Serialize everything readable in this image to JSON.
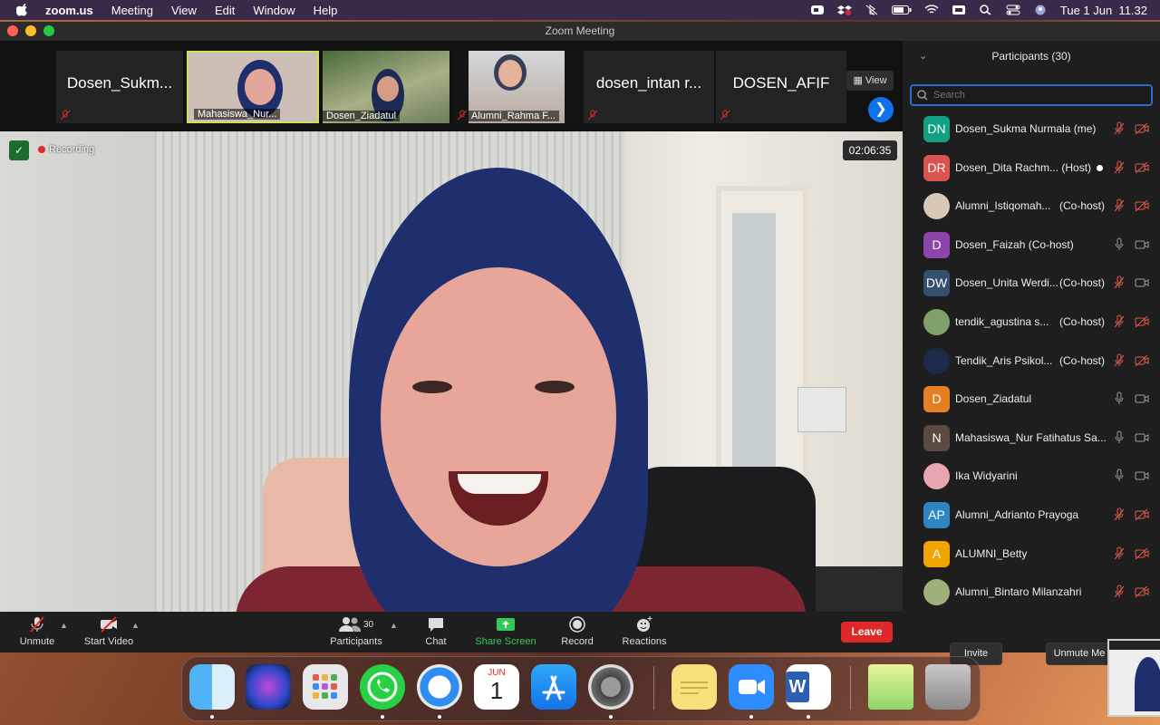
{
  "menubar": {
    "app": "zoom.us",
    "items": [
      "Meeting",
      "View",
      "Edit",
      "Window",
      "Help"
    ],
    "clock": "Tue 1 Jun  11.32"
  },
  "window": {
    "title": "Zoom Meeting"
  },
  "strip": {
    "view_label": "View",
    "thumbs": [
      {
        "name": "Dosen_Sukm..."
      },
      {
        "name": "Mahasiswa_Nur..."
      },
      {
        "name": "Dosen_Ziadatul"
      },
      {
        "name": "Alumni_Rahma F..."
      },
      {
        "name": "dosen_intan r..."
      },
      {
        "name": "DOSEN_AFIF"
      }
    ]
  },
  "video": {
    "recording_label": "Recording",
    "timer": "02:06:35"
  },
  "toolbar": {
    "unmute": "Unmute",
    "start_video": "Start Video",
    "participants": "Participants",
    "participants_count": "30",
    "chat": "Chat",
    "share_screen": "Share Screen",
    "record": "Record",
    "reactions": "Reactions",
    "leave": "Leave"
  },
  "panel": {
    "title": "Participants (30)",
    "search_placeholder": "Search",
    "invite": "Invite",
    "unmute_me": "Unmute Me",
    "participants": [
      {
        "initials": "DN",
        "name": "Dosen_Sukma Nurmala (me)",
        "role": "",
        "color": "#12a085",
        "mic": "muted",
        "cam": "off"
      },
      {
        "initials": "DR",
        "name": "Dosen_Dita Rachm... (Host)",
        "role": "",
        "color": "#d9534f",
        "mic": "muted",
        "cam": "off"
      },
      {
        "initials": "",
        "name": "Alumni_Istiqomah...",
        "role": "(Co-host)",
        "color": "#d8c8b8",
        "mic": "muted",
        "cam": "off"
      },
      {
        "initials": "D",
        "name": "Dosen_Faizah (Co-host)",
        "role": "",
        "color": "#8e44ad",
        "mic": "on",
        "cam": "on"
      },
      {
        "initials": "DW",
        "name": "Dosen_Unita Werdi...",
        "role": "(Co-host)",
        "color": "#35506e",
        "mic": "muted",
        "cam": "on"
      },
      {
        "initials": "",
        "name": "tendik_agustina  s...",
        "role": "(Co-host)",
        "color": "#7fa06a",
        "mic": "muted",
        "cam": "off"
      },
      {
        "initials": "",
        "name": "Tendik_Aris Psikol...",
        "role": "(Co-host)",
        "color": "#1d2b4a",
        "mic": "muted",
        "cam": "off"
      },
      {
        "initials": "D",
        "name": "Dosen_Ziadatul",
        "role": "",
        "color": "#e67e22",
        "mic": "on",
        "cam": "on"
      },
      {
        "initials": "N",
        "name": "Mahasiswa_Nur Fatihatus Sa...",
        "role": "",
        "color": "#5a4a42",
        "mic": "on",
        "cam": "on"
      },
      {
        "initials": "",
        "name": "Ika Widyarini",
        "role": "",
        "color": "#e8a6b0",
        "mic": "on",
        "cam": "on"
      },
      {
        "initials": "AP",
        "name": "Alumni_Adrianto Prayoga",
        "role": "",
        "color": "#2e86c1",
        "mic": "muted",
        "cam": "off"
      },
      {
        "initials": "A",
        "name": "ALUMNI_Betty",
        "role": "",
        "color": "#f0a500",
        "mic": "muted",
        "cam": "off"
      },
      {
        "initials": "",
        "name": "Alumni_Bintaro Milanzahri",
        "role": "",
        "color": "#a0b07a",
        "mic": "muted",
        "cam": "off"
      }
    ]
  },
  "dock": {
    "calendar_month": "JUN",
    "calendar_day": "1",
    "apps": [
      "finder-icon",
      "siri-icon",
      "launchpad-icon",
      "whatsapp-icon",
      "safari-icon",
      "calendar-icon",
      "app-store-icon",
      "system-preferences-icon",
      "stickies-icon",
      "zoom-icon",
      "word-icon",
      "document-thumbnail",
      "trash-icon"
    ]
  }
}
